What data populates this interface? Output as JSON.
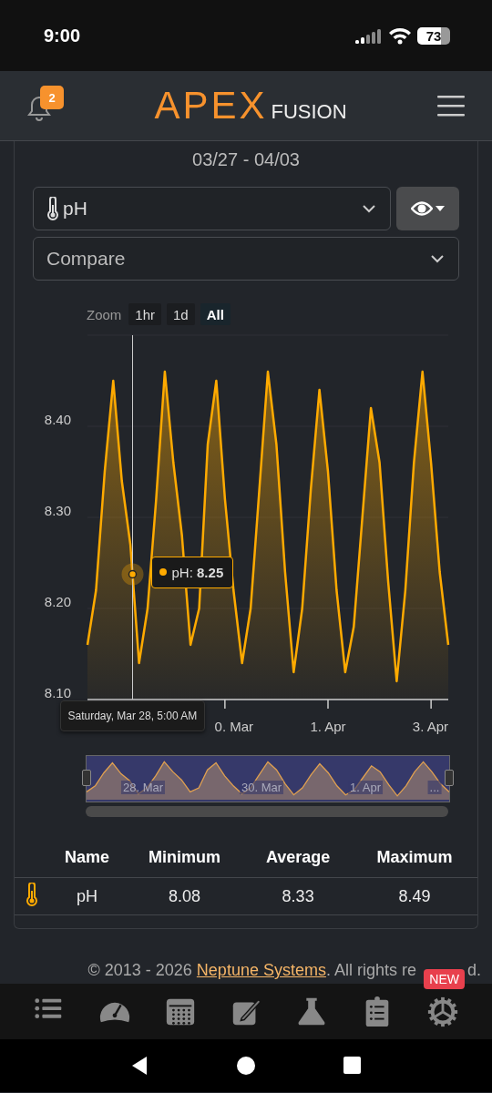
{
  "status_bar": {
    "time": "9:00",
    "battery": "73"
  },
  "header": {
    "notifications": "2",
    "logo_main": "APEX",
    "logo_sub": "FUSION"
  },
  "date_range": "03/27 - 04/03",
  "probe_select": {
    "value": "pH"
  },
  "compare_select": {
    "value": "Compare"
  },
  "zoom": {
    "label": "Zoom",
    "options": [
      {
        "label": "1hr",
        "selected": false
      },
      {
        "label": "1d",
        "selected": false
      },
      {
        "label": "All",
        "selected": true
      }
    ]
  },
  "chart": {
    "chart_data": {
      "type": "area",
      "categories": [
        null,
        null,
        null,
        null,
        null,
        null,
        null,
        null,
        null,
        null,
        null,
        null,
        null,
        null,
        null,
        null,
        "0. Mar",
        null,
        null,
        null,
        null,
        null,
        null,
        null,
        null,
        null,
        null,
        null,
        "1. Apr",
        null,
        null,
        null,
        null,
        null,
        null,
        null,
        null,
        null,
        null,
        null,
        "3. Apr",
        null,
        null
      ],
      "series": [
        {
          "name": "pH",
          "color": "#ffaa00",
          "values": [
            8.16,
            8.22,
            8.35,
            8.45,
            8.34,
            8.27,
            8.14,
            8.2,
            8.32,
            8.46,
            8.36,
            8.28,
            8.16,
            8.2,
            8.38,
            8.45,
            8.32,
            8.22,
            8.14,
            8.2,
            8.33,
            8.46,
            8.38,
            8.24,
            8.13,
            8.2,
            8.33,
            8.44,
            8.35,
            8.22,
            8.13,
            8.18,
            8.3,
            8.42,
            8.36,
            8.23,
            8.12,
            8.22,
            8.36,
            8.46,
            8.36,
            8.24,
            8.16
          ]
        }
      ],
      "ylim": [
        8.1,
        8.5
      ],
      "grid": true,
      "yticks": [
        {
          "value": 8.1,
          "label": "8.10"
        },
        {
          "value": 8.2,
          "label": "8.20"
        },
        {
          "value": 8.3,
          "label": "8.30"
        },
        {
          "value": 8.4,
          "label": "8.40"
        }
      ]
    },
    "tooltip": {
      "separator": ":",
      "value": "8.25",
      "date": "Saturday, Mar 28, 5:00 AM"
    }
  },
  "navigator": {
    "labels": [
      "28. Mar",
      "30. Mar",
      "1. Apr",
      "..."
    ]
  },
  "table": {
    "columns": [
      "Name",
      "Minimum",
      "Average",
      "Maximum"
    ],
    "rows": [
      {
        "name": "pH",
        "minimum": "8.08",
        "average": "8.33",
        "maximum": "8.49"
      }
    ]
  },
  "footer": {
    "prefix": "© 2013 - 2026 ",
    "link": "Neptune Systems",
    "suffix": ". All rights re",
    "tail": "d."
  },
  "bottom_nav": {
    "badge": "NEW"
  }
}
